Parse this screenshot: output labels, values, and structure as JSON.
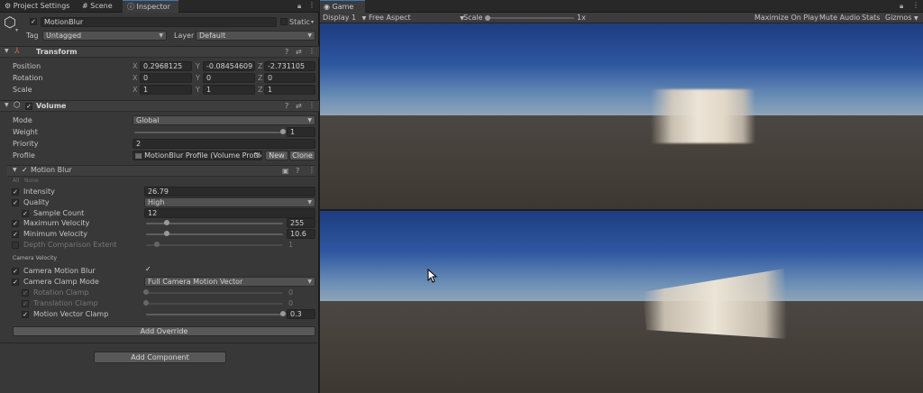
{
  "tabs": {
    "project_settings": "Project Settings",
    "scene": "Scene",
    "inspector": "Inspector"
  },
  "object": {
    "name": "MotionBlur",
    "static_label": "Static",
    "tag_label": "Tag",
    "tag_value": "Untagged",
    "layer_label": "Layer",
    "layer_value": "Default"
  },
  "transform": {
    "title": "Transform",
    "rows": [
      {
        "label": "Position",
        "x": "0.2968125",
        "y": "-0.08454609",
        "z": "-2.731105"
      },
      {
        "label": "Rotation",
        "x": "0",
        "y": "0",
        "z": "0"
      },
      {
        "label": "Scale",
        "x": "1",
        "y": "1",
        "z": "1"
      }
    ],
    "axis": {
      "x": "X",
      "y": "Y",
      "z": "Z"
    }
  },
  "volume": {
    "title": "Volume",
    "mode_label": "Mode",
    "mode_value": "Global",
    "weight_label": "Weight",
    "weight_value": "1",
    "weight_fraction": 1.0,
    "priority_label": "Priority",
    "priority_value": "2",
    "profile_label": "Profile",
    "profile_value": "MotionBlur Profile (Volume Profile)",
    "new_button": "New",
    "clone_button": "Clone"
  },
  "motion_blur": {
    "title": "Motion Blur",
    "all": "All",
    "none": "None",
    "intensity_label": "Intensity",
    "intensity_value": "26.79",
    "quality_label": "Quality",
    "quality_value": "High",
    "sample_count_label": "Sample Count",
    "sample_count_value": "12",
    "max_velocity_label": "Maximum Velocity",
    "max_velocity_value": "255",
    "max_velocity_fraction": 0.15,
    "min_velocity_label": "Minimum Velocity",
    "min_velocity_value": "10.6",
    "min_velocity_fraction": 0.15,
    "depth_label": "Depth Comparison Extent",
    "depth_value": "1",
    "depth_fraction": 0.08,
    "camera_velocity_header": "Camera Velocity",
    "camera_blur_label": "Camera Motion Blur",
    "clamp_mode_label": "Camera Clamp Mode",
    "clamp_mode_value": "Full Camera Motion Vector",
    "rotation_clamp_label": "Rotation Clamp",
    "rotation_clamp_value": "0",
    "translation_clamp_label": "Translation Clamp",
    "translation_clamp_value": "0",
    "motion_vector_clamp_label": "Motion Vector Clamp",
    "motion_vector_clamp_value": "0.3",
    "motion_vector_clamp_fraction": 1.0
  },
  "buttons": {
    "add_override": "Add Override",
    "add_component": "Add Component"
  },
  "game": {
    "tab": "Game",
    "display": "Display 1",
    "aspect": "Free Aspect",
    "scale_label": "Scale",
    "scale_value": "1x",
    "maximize": "Maximize On Play",
    "mute": "Mute Audio",
    "stats": "Stats",
    "gizmos": "Gizmos"
  }
}
